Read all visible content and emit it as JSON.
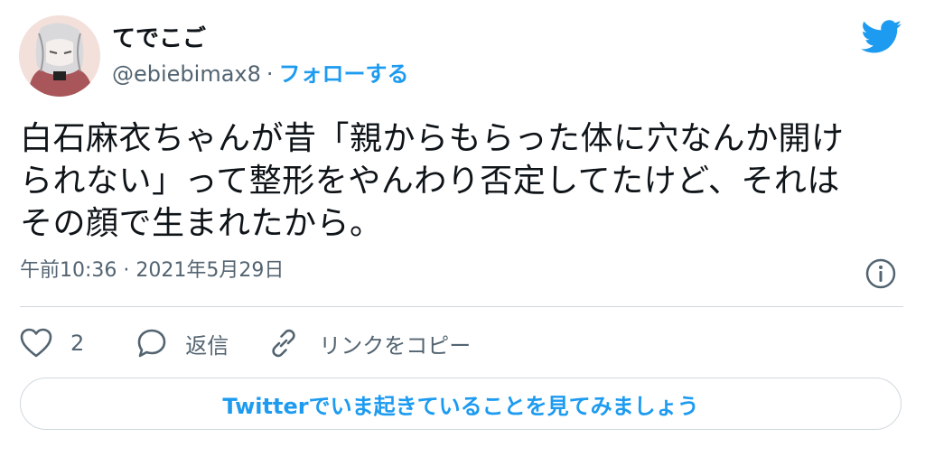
{
  "user": {
    "display_name": "てでこご",
    "handle": "@ebiebimax8",
    "separator": "·",
    "follow_label": "フォローする",
    "avatar_icon": "user-avatar"
  },
  "brand": {
    "icon": "twitter-bird-icon",
    "color": "#1d9bf0"
  },
  "tweet": {
    "lines": [
      "白石麻衣ちゃんが昔「親からもらった体に穴なんか開け",
      "られない」って整形をやんわり否定してたけど、それは",
      "その顔で生まれたから。"
    ],
    "timestamp": "午前10:36 · 2021年5月29日"
  },
  "actions": {
    "like_count": "2",
    "reply_label": "返信",
    "copy_link_label": "リンクをコピー"
  },
  "cta": {
    "label": "Twitterでいま起きていることを見てみましょう"
  },
  "colors": {
    "text_primary": "#0f1419",
    "text_secondary": "#536471",
    "border": "#cfd9de"
  }
}
